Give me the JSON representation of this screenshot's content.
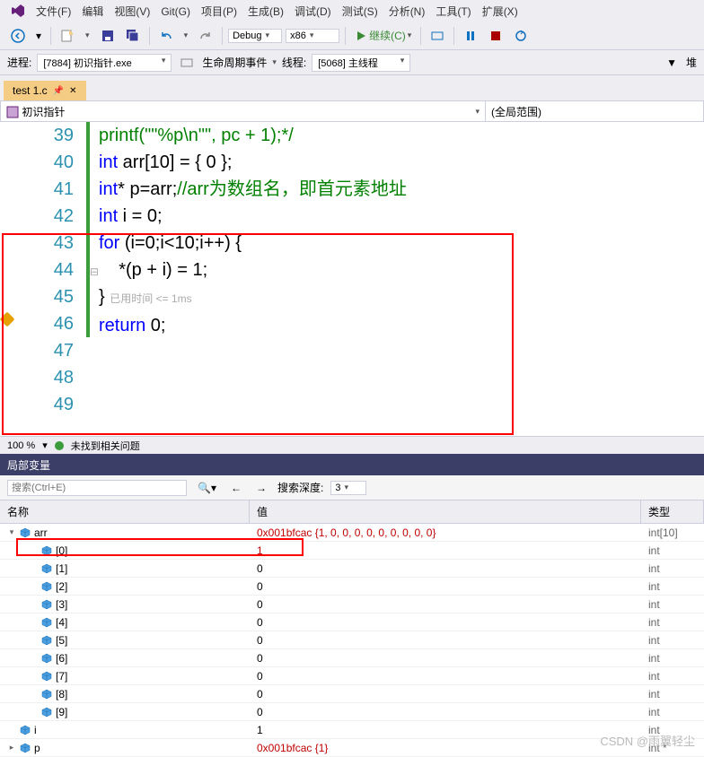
{
  "menu": [
    "文件(F)",
    "编辑",
    "视图(V)",
    "Git(G)",
    "项目(P)",
    "生成(B)",
    "调试(D)",
    "测试(S)",
    "分析(N)",
    "工具(T)",
    "扩展(X)"
  ],
  "configs": {
    "config": "Debug",
    "platform": "x86",
    "run": "继续(C)"
  },
  "procbar": {
    "proc_label": "进程:",
    "proc_value": "[7884] 初识指针.exe",
    "life": "生命周期事件",
    "thread_label": "线程:",
    "thread_value": "[5068] 主线程",
    "stack": "堆"
  },
  "tab": {
    "name": "test 1.c"
  },
  "nav": {
    "left": "初识指针",
    "right": "(全局范围)"
  },
  "lines": [
    {
      "n": "39",
      "html": "printf(~\"%p\\n\"~, pc + 1);*/",
      "cls": "com"
    },
    {
      "n": "40",
      "html": ""
    },
    {
      "n": "41",
      "parts": [
        {
          "t": "int",
          "c": "kw"
        },
        {
          "t": " arr[10] = { 0 };"
        }
      ]
    },
    {
      "n": "42",
      "parts": [
        {
          "t": "int",
          "c": "kw"
        },
        {
          "t": "* p=arr;"
        },
        {
          "t": "//arr为数组名，即首元素地址",
          "c": "com"
        }
      ]
    },
    {
      "n": "43",
      "parts": [
        {
          "t": "int",
          "c": "kw"
        },
        {
          "t": " i = 0;"
        }
      ]
    },
    {
      "n": "44",
      "parts": [
        {
          "t": "for",
          "c": "kw"
        },
        {
          "t": " (i=0;i<10;i++) {"
        }
      ]
    },
    {
      "n": "45",
      "html": "    *(p + i) = 1;"
    },
    {
      "n": "46",
      "parts": [
        {
          "t": "} "
        },
        {
          "t": "已用时间 <= 1ms",
          "c": "hint"
        }
      ]
    },
    {
      "n": "47",
      "html": ""
    },
    {
      "n": "48",
      "html": ""
    },
    {
      "n": "49",
      "parts": [
        {
          "t": "return",
          "c": "kw"
        },
        {
          "t": " 0;"
        }
      ]
    }
  ],
  "status": {
    "zoom": "100 %",
    "msg": "未找到相关问题"
  },
  "locals": {
    "title": "局部变量",
    "search_ph": "搜索(Ctrl+E)",
    "depth_label": "搜索深度:",
    "depth_val": "3",
    "cols": {
      "name": "名称",
      "val": "值",
      "type": "类型"
    },
    "rows": [
      {
        "lvl": 1,
        "exp": "▾",
        "name": "arr",
        "val": "0x001bfcac {1, 0, 0, 0, 0, 0, 0, 0, 0, 0}",
        "type": "int[10]",
        "red": true
      },
      {
        "lvl": 2,
        "exp": "",
        "name": "[0]",
        "val": "1",
        "type": "int",
        "red": true,
        "hl": true
      },
      {
        "lvl": 2,
        "exp": "",
        "name": "[1]",
        "val": "0",
        "type": "int"
      },
      {
        "lvl": 2,
        "exp": "",
        "name": "[2]",
        "val": "0",
        "type": "int"
      },
      {
        "lvl": 2,
        "exp": "",
        "name": "[3]",
        "val": "0",
        "type": "int"
      },
      {
        "lvl": 2,
        "exp": "",
        "name": "[4]",
        "val": "0",
        "type": "int"
      },
      {
        "lvl": 2,
        "exp": "",
        "name": "[5]",
        "val": "0",
        "type": "int"
      },
      {
        "lvl": 2,
        "exp": "",
        "name": "[6]",
        "val": "0",
        "type": "int"
      },
      {
        "lvl": 2,
        "exp": "",
        "name": "[7]",
        "val": "0",
        "type": "int"
      },
      {
        "lvl": 2,
        "exp": "",
        "name": "[8]",
        "val": "0",
        "type": "int"
      },
      {
        "lvl": 2,
        "exp": "",
        "name": "[9]",
        "val": "0",
        "type": "int"
      },
      {
        "lvl": 1,
        "exp": "",
        "name": "i",
        "val": "1",
        "type": "int"
      },
      {
        "lvl": 1,
        "exp": "▸",
        "name": "p",
        "val": "0x001bfcac {1}",
        "type": "int *",
        "red": true
      }
    ]
  },
  "watermark": "CSDN @雨翼轻尘"
}
